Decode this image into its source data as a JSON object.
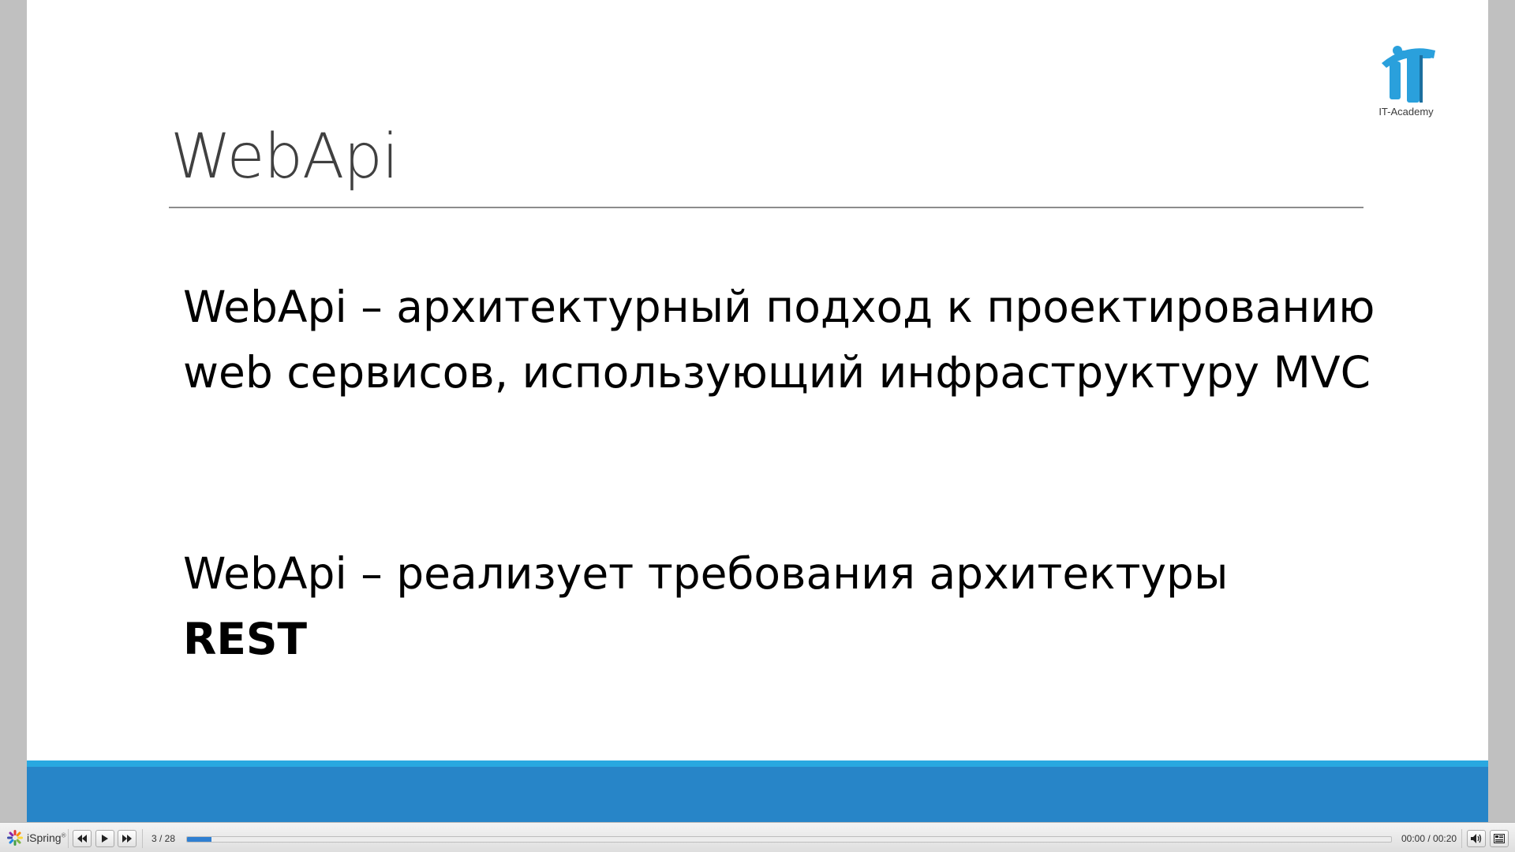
{
  "slide": {
    "title": "WebApi",
    "logo_caption": "IT-Academy",
    "paragraph1": "WebApi – архитектурный подход к проектированию web сервисов, использующий инфраструктуру MVC",
    "paragraph2_text": "WebApi – реализует требования архитектуры ",
    "paragraph2_bold": "REST"
  },
  "colors": {
    "accent_strip": "#29a8e0",
    "footer_band": "#2785c8",
    "logo_blue": "#2aa0dc",
    "progress_fill": "#2f7fd1"
  },
  "player": {
    "brand": "iSpring",
    "brand_reg": "®",
    "slide_counter": "3 / 28",
    "time_display": "00:00 / 00:20",
    "progress_fraction": 0.02,
    "icons": {
      "logo": "ispring-logo-icon",
      "prev": "rewind-icon",
      "play": "play-icon",
      "next": "fast-forward-icon",
      "volume": "volume-icon",
      "outline": "outline-panel-icon"
    }
  }
}
